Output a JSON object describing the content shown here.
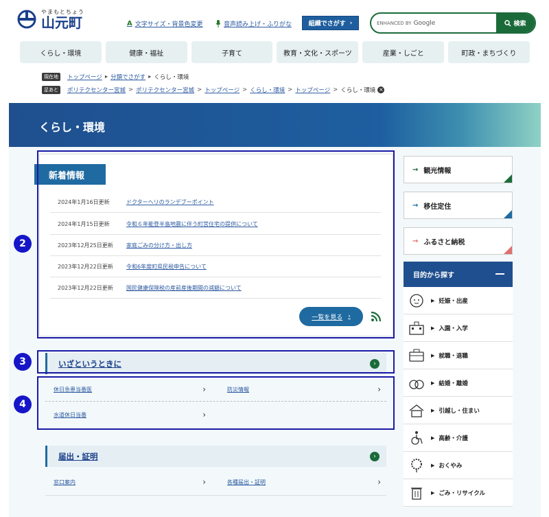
{
  "header": {
    "logo_kana": "やまもとちょう",
    "logo_name": "山元町",
    "text_size_link": "文字サイズ・背景色変更",
    "text_size_icon": "A",
    "voice_link": "音声読み上げ・ふりがな",
    "org_search_button": "組織でさがす",
    "search_placeholder": "ENHANCED BY",
    "search_google": "Google",
    "search_button": "検索"
  },
  "nav": {
    "items": [
      "くらし・環境",
      "健康・福祉",
      "子育て",
      "教育・文化・スポーツ",
      "産業・しごと",
      "町政・まちづくり"
    ]
  },
  "breadcrumb": {
    "current_tag": "現在地",
    "current": [
      "トップページ",
      "分類でさがす",
      "くらし・環境"
    ],
    "history_tag": "足あと",
    "history": [
      "ポリテクセンター宮城",
      "ポリテクセンター宮城",
      "トップページ",
      "くらし・環境",
      "トップページ",
      "くらし・環境"
    ]
  },
  "page_title": "くらし・環境",
  "news": {
    "heading": "新着情報",
    "items": [
      {
        "date": "2024年1月16日更新",
        "title": "ドクターヘリのランデブーポイント"
      },
      {
        "date": "2024年1月15日更新",
        "title": "令和６年能登半島地震に伴う町営住宅の提供について"
      },
      {
        "date": "2023年12月25日更新",
        "title": "家庭ごみの分け方・出し方"
      },
      {
        "date": "2023年12月22日更新",
        "title": "令和6年度町県民税申告について"
      },
      {
        "date": "2023年12月22日更新",
        "title": "国民健康保険税の産前産後期間の減額について"
      }
    ],
    "more_button": "一覧を見る"
  },
  "emergency": {
    "heading": "いざというときに",
    "links": [
      "休日急患当番医",
      "防災情報",
      "水道休日当番"
    ]
  },
  "certificates": {
    "heading": "届出・証明",
    "links": [
      "窓口案内",
      "各種届出・証明"
    ]
  },
  "side": {
    "buttons": [
      {
        "label": "観光情報",
        "color": "#1b6b3a"
      },
      {
        "label": "移住定住",
        "color": "#1f6aa1"
      },
      {
        "label": "ふるさと納税",
        "color": "#e07070"
      }
    ],
    "purpose_heading": "目的から探す",
    "purpose_items": [
      "妊娠・出産",
      "入園・入学",
      "就職・退職",
      "結婚・離婚",
      "引越し・住まい",
      "高齢・介護",
      "おくやみ",
      "ごみ・リサイクル"
    ]
  },
  "annotations": [
    "2",
    "3",
    "4"
  ],
  "colors": {
    "brand_blue": "#1f4f8e",
    "accent_green": "#1b6b3a",
    "link_blue": "#2c5aa0"
  }
}
